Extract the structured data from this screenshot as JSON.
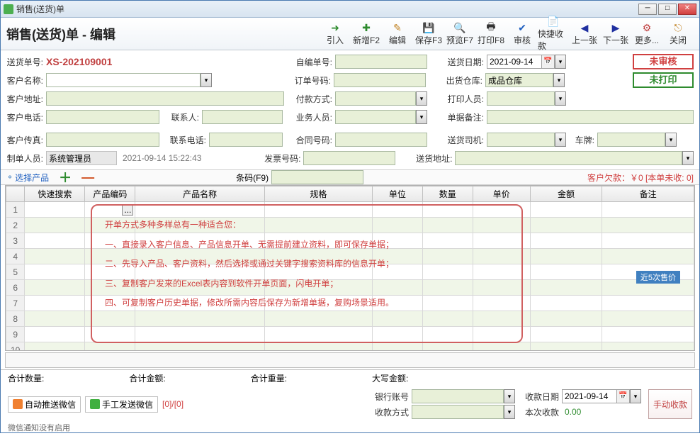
{
  "window": {
    "title": "销售(送货)单"
  },
  "header": {
    "title": "销售(送货)单 - 编辑"
  },
  "toolbar": [
    {
      "name": "import",
      "label": "引入",
      "icon": "➜",
      "color": "#2e8b2e"
    },
    {
      "name": "new",
      "label": "新增F2",
      "icon": "✚",
      "color": "#2e8b2e"
    },
    {
      "name": "edit",
      "label": "编辑",
      "icon": "✎",
      "color": "#c08020"
    },
    {
      "name": "save",
      "label": "保存F3",
      "icon": "💾",
      "color": "#333"
    },
    {
      "name": "preview",
      "label": "预览F7",
      "icon": "🔍",
      "color": "#333"
    },
    {
      "name": "print",
      "label": "打印F8",
      "icon": "🖶",
      "color": "#333"
    },
    {
      "name": "audit",
      "label": "审核",
      "icon": "✔",
      "color": "#2060c0"
    },
    {
      "name": "quickpay",
      "label": "快捷收款",
      "icon": "📄",
      "color": "#c08020"
    },
    {
      "name": "prev",
      "label": "上一张",
      "icon": "◀",
      "color": "#2030a0"
    },
    {
      "name": "next",
      "label": "下一张",
      "icon": "▶",
      "color": "#2030a0"
    },
    {
      "name": "more",
      "label": "更多...",
      "icon": "⚙",
      "color": "#c04040"
    },
    {
      "name": "close",
      "label": "关闭",
      "icon": "⎋",
      "color": "#c08020"
    }
  ],
  "form": {
    "delivery_no_label": "送货单号:",
    "delivery_no": "XS-202109001",
    "self_no_label": "自编单号:",
    "self_no": "",
    "delivery_date_label": "送货日期:",
    "delivery_date": "2021-09-14",
    "customer_label": "客户名称:",
    "customer": "",
    "order_no_label": "订单号码:",
    "order_no": "",
    "out_wh_label": "出货仓库:",
    "out_wh": "成品仓库",
    "addr_label": "客户地址:",
    "addr": "",
    "pay_method_label": "付款方式:",
    "pay_method": "",
    "printer_label": "打印人员:",
    "printer": "",
    "phone_label": "客户电话:",
    "phone": "",
    "contact_label": "联系人:",
    "contact": "",
    "sales_label": "业务人员:",
    "sales": "",
    "remark_label": "单据备注:",
    "remark": "",
    "fax_label": "客户传真:",
    "fax": "",
    "contact_phone_label": "联系电话:",
    "contact_phone": "",
    "contract_label": "合同号码:",
    "contract": "",
    "driver_label": "送货司机:",
    "driver": "",
    "plate_label": "车牌:",
    "plate": "",
    "maker_label": "制单人员:",
    "maker": "系统管理员",
    "maker_time": "2021-09-14 15:22:43",
    "invoice_label": "发票号码:",
    "invoice": "",
    "ship_addr_label": "送货地址:",
    "ship_addr": ""
  },
  "status": {
    "unaudited": "未审核",
    "unprinted": "未打印"
  },
  "strip": {
    "select_product": "选择产品",
    "barcode_label": "条码(F9)",
    "barcode": "",
    "debt": "客户欠款：￥0 [本单未收: 0]"
  },
  "grid": {
    "cols": [
      "",
      "快速搜索",
      "产品编码",
      "产品名称",
      "规格",
      "单位",
      "数量",
      "单价",
      "金额",
      "备注"
    ],
    "rows": 11
  },
  "tips": {
    "l0": "开单方式多种多样总有一种适合您：",
    "l1": "一、直接录入客户信息、产品信息开单、无需提前建立资料，即可保存单据；",
    "l2": "二、先导入产品、客户资料，然后选择或通过关键字搜索资料库的信息开单；",
    "l3": "三、复制客户发来的Excel表内容到软件开单页面，闪电开单；",
    "l4": "四、可复制客户历史单据，修改所需内容后保存为新增单据，复购场景适用。"
  },
  "price_tip": "近5次售价",
  "totals": {
    "qty_label": "合计数量:",
    "amt_label": "合计金额:",
    "wt_label": "合计重量:",
    "cap_label": "大写金额:"
  },
  "bottom": {
    "auto_push": "自动推送微信",
    "manual_send": "手工发送微信",
    "counter": "[0]/[0]",
    "bank_label": "银行账号",
    "bank": "",
    "recv_date_label": "收款日期",
    "recv_date": "2021-09-14",
    "method_label": "收款方式",
    "method": "",
    "this_label": "本次收款",
    "this_amt": "0.00",
    "manual_btn": "手动收款"
  },
  "footer": "微信通知没有启用"
}
